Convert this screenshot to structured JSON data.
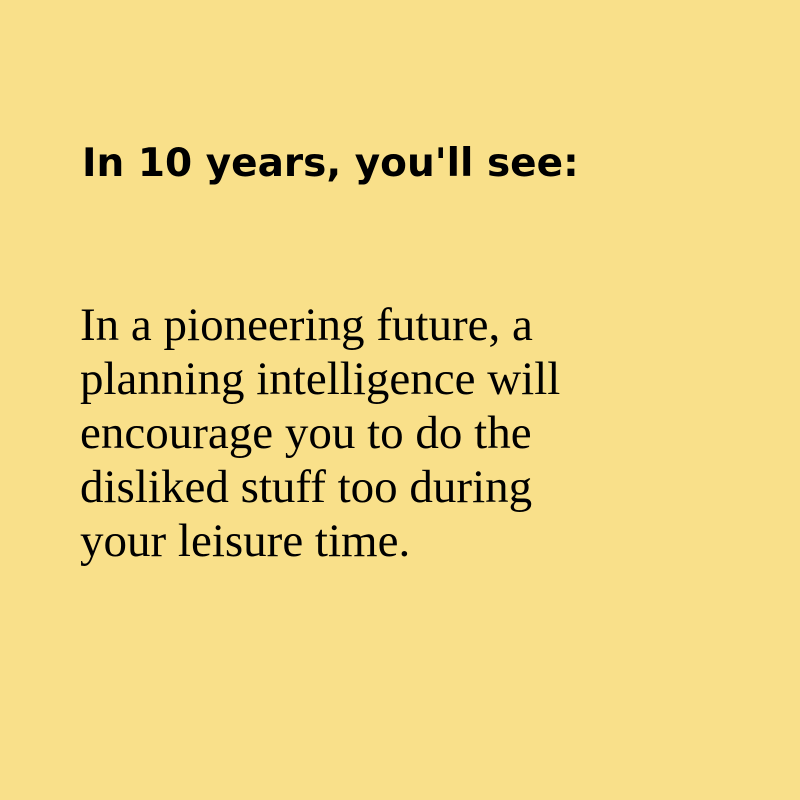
{
  "card": {
    "background_color": "#f9e08a",
    "text_color": "#000000",
    "headline": "In 10 years, you'll see:",
    "body_lines": [
      "In a pioneering future, a",
      "planning intelligence will",
      "encourage you to do the",
      "disliked stuff too during",
      "your leisure time."
    ]
  }
}
